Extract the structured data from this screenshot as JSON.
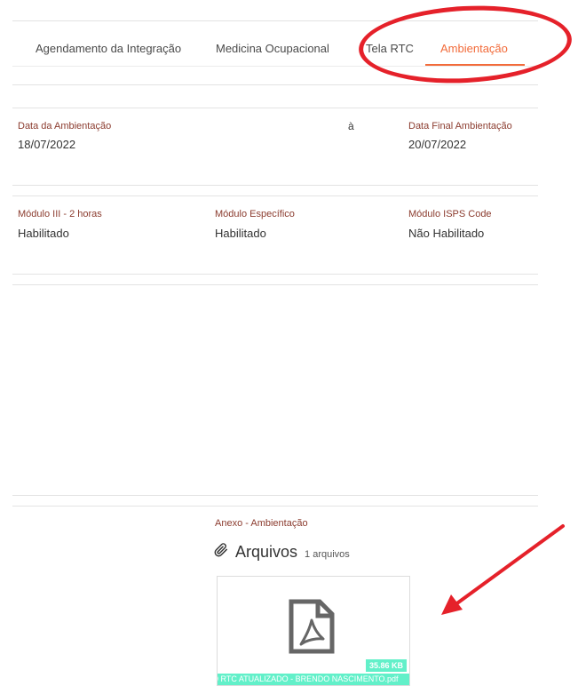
{
  "tabs": [
    {
      "label": "Agendamento da Integração"
    },
    {
      "label": "Medicina Ocupacional"
    },
    {
      "label": "Tela RTC"
    },
    {
      "label": "Ambientação"
    }
  ],
  "dates": {
    "start_label": "Data da Ambientação",
    "start_value": "18/07/2022",
    "separator": "à",
    "end_label": "Data Final Ambientação",
    "end_value": "20/07/2022"
  },
  "modules": [
    {
      "label": "Módulo III - 2 horas",
      "value": "Habilitado"
    },
    {
      "label": "Módulo Específico",
      "value": "Habilitado"
    },
    {
      "label": "Módulo ISPS Code",
      "value": "Não Habilitado"
    }
  ],
  "attachment": {
    "section_label": "Anexo - Ambientação",
    "title": "Arquivos",
    "count": "1 arquivos",
    "file": {
      "size": "35.86 KB",
      "name": "0 RTC ATUALIZADO - BRENDO NASCIMENTO.pdf"
    }
  },
  "colors": {
    "accent": "#f26b3a",
    "label": "#8b3b2e",
    "badge": "#62f0c9",
    "annotation": "#e5212a"
  },
  "icons": [
    "paperclip-icon",
    "pdf-file-icon",
    "annotation-ellipse",
    "annotation-arrow"
  ]
}
